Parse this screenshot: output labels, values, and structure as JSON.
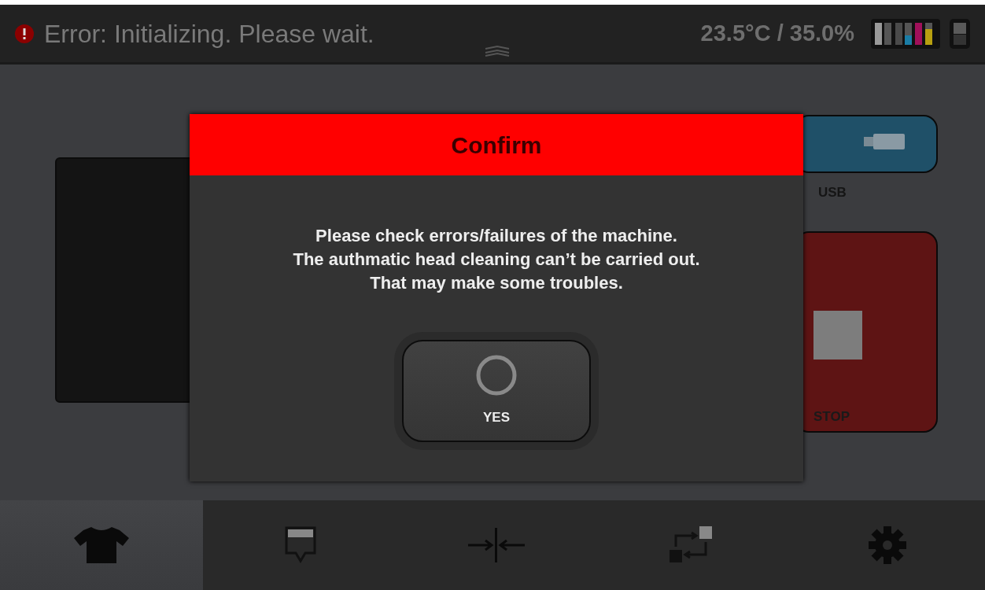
{
  "status_bar": {
    "message": "Error: Initializing. Please wait.",
    "error": true,
    "reading": "23.5°C / 35.0%"
  },
  "side_buttons": [
    {
      "kind": "usb",
      "label": "USB"
    },
    {
      "kind": "stop",
      "label": "STOP"
    }
  ],
  "dialog": {
    "title": "Confirm",
    "message_lines": [
      "Please check errors/failures of the machine.",
      "The authmatic head cleaning can’t be carried out.",
      "That may make some troubles."
    ],
    "button": "YES"
  },
  "bottom_tabs": [
    {
      "kind": "shirt",
      "selected": true
    },
    {
      "kind": "ink",
      "selected": false
    },
    {
      "kind": "align",
      "selected": false
    },
    {
      "kind": "transfer",
      "selected": false
    },
    {
      "kind": "settings",
      "selected": false
    }
  ]
}
